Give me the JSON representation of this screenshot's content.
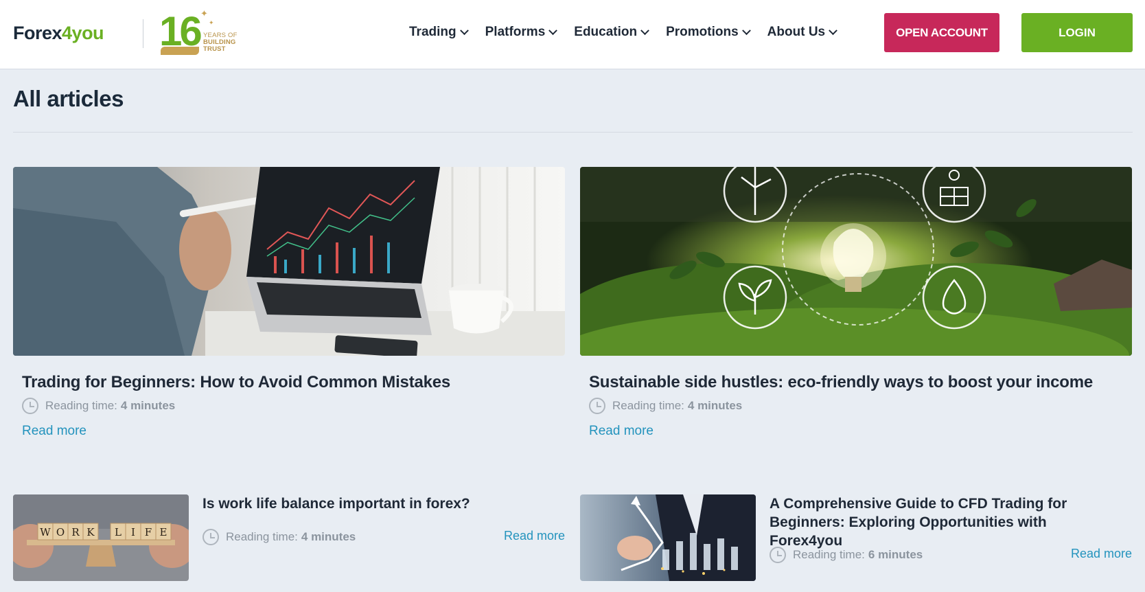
{
  "brand": {
    "logo_part1": "Forex",
    "logo_part2": "4you",
    "anniversary_number": "16",
    "anniversary_line1": "Years of",
    "anniversary_line2": "Building",
    "anniversary_line3": "Trust"
  },
  "nav": {
    "items": [
      {
        "label": "Trading"
      },
      {
        "label": "Platforms"
      },
      {
        "label": "Education"
      },
      {
        "label": "Promotions"
      },
      {
        "label": "About Us"
      }
    ],
    "open_account": "OPEN ACCOUNT",
    "login": "LOGIN"
  },
  "colors": {
    "brand_green": "#6ab023",
    "open_account": "#c7285a",
    "link": "#2393bd",
    "background": "#e8edf3"
  },
  "page": {
    "title": "All articles"
  },
  "articles": [
    {
      "title": "Trading for Beginners: How to Avoid Common Mistakes",
      "reading_label": "Reading time:",
      "reading_time": "4 minutes",
      "read_more": "Read more",
      "image": "laptop-trading-chart"
    },
    {
      "title": "Sustainable side hustles: eco-friendly ways to boost your income",
      "reading_label": "Reading time:",
      "reading_time": "4 minutes",
      "read_more": "Read more",
      "image": "eco-lightbulb-moss"
    },
    {
      "title": "Is work life balance important in forex?",
      "reading_label": "Reading time:",
      "reading_time": "4 minutes",
      "read_more": "Read more",
      "image": "work-life-balance-blocks",
      "image_words": [
        "WORK",
        "LIFE"
      ]
    },
    {
      "title": "A Comprehensive Guide to CFD Trading for Beginners: Exploring Opportunities with Forex4you",
      "reading_label": "Reading time:",
      "reading_time": "6 minutes",
      "read_more": "Read more",
      "image": "businessman-growth-chart"
    }
  ]
}
